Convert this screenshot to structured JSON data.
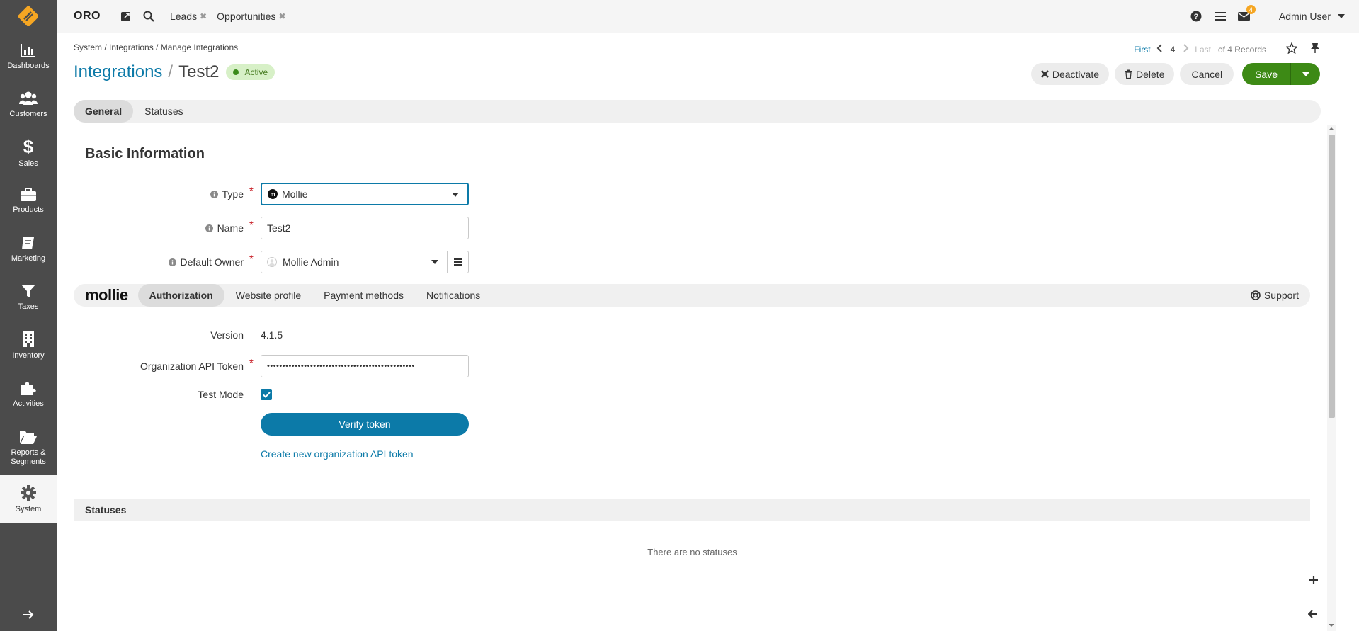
{
  "app": {
    "brand": "ORO"
  },
  "topbar": {
    "pinned_tabs": [
      {
        "label": "Leads"
      },
      {
        "label": "Opportunities"
      }
    ],
    "notifications_count": "4",
    "user_name": "Admin User"
  },
  "sidebar": {
    "items": [
      {
        "label": "Dashboards",
        "icon": "chart-icon"
      },
      {
        "label": "Customers",
        "icon": "users-icon"
      },
      {
        "label": "Sales",
        "icon": "dollar-icon"
      },
      {
        "label": "Products",
        "icon": "briefcase-icon"
      },
      {
        "label": "Marketing",
        "icon": "book-icon"
      },
      {
        "label": "Taxes",
        "icon": "filter-icon"
      },
      {
        "label": "Inventory",
        "icon": "building-icon"
      },
      {
        "label": "Activities",
        "icon": "puzzle-icon"
      },
      {
        "label": "Reports &",
        "label2": "Segments",
        "icon": "folder-icon"
      },
      {
        "label": "System",
        "icon": "gear-icon"
      }
    ]
  },
  "breadcrumb": "System / Integrations / Manage Integrations",
  "pager": {
    "first": "First",
    "current": "4",
    "last": "Last",
    "summary": "of 4 Records"
  },
  "title": {
    "link": "Integrations",
    "separator": "/",
    "name": "Test2",
    "status": "Active"
  },
  "actions": {
    "deactivate": "Deactivate",
    "delete": "Delete",
    "cancel": "Cancel",
    "save": "Save"
  },
  "tabs": [
    {
      "label": "General",
      "active": true
    },
    {
      "label": "Statuses",
      "active": false
    }
  ],
  "basic_info": {
    "heading": "Basic Information",
    "type_label": "Type",
    "type_value": "Mollie",
    "name_label": "Name",
    "name_value": "Test2",
    "owner_label": "Default Owner",
    "owner_value": "Mollie Admin"
  },
  "mollie": {
    "logo_text": "mollie",
    "tabs": [
      {
        "label": "Authorization",
        "active": true
      },
      {
        "label": "Website profile",
        "active": false
      },
      {
        "label": "Payment methods",
        "active": false
      },
      {
        "label": "Notifications",
        "active": false
      }
    ],
    "support": "Support"
  },
  "auth": {
    "version_label": "Version",
    "version_value": "4.1.5",
    "token_label": "Organization API Token",
    "token_value": "••••••••••••••••••••••••••••••••••••••••••••••••",
    "test_mode_label": "Test Mode",
    "test_mode_checked": true,
    "verify_button": "Verify token",
    "create_token_link": "Create new organization API token"
  },
  "statuses": {
    "heading": "Statuses",
    "empty": "There are no statuses"
  },
  "colors": {
    "accent": "#0c7aa8",
    "save": "#3d8a15",
    "sidebar": "#4b4b4b",
    "required": "#c81d25"
  }
}
